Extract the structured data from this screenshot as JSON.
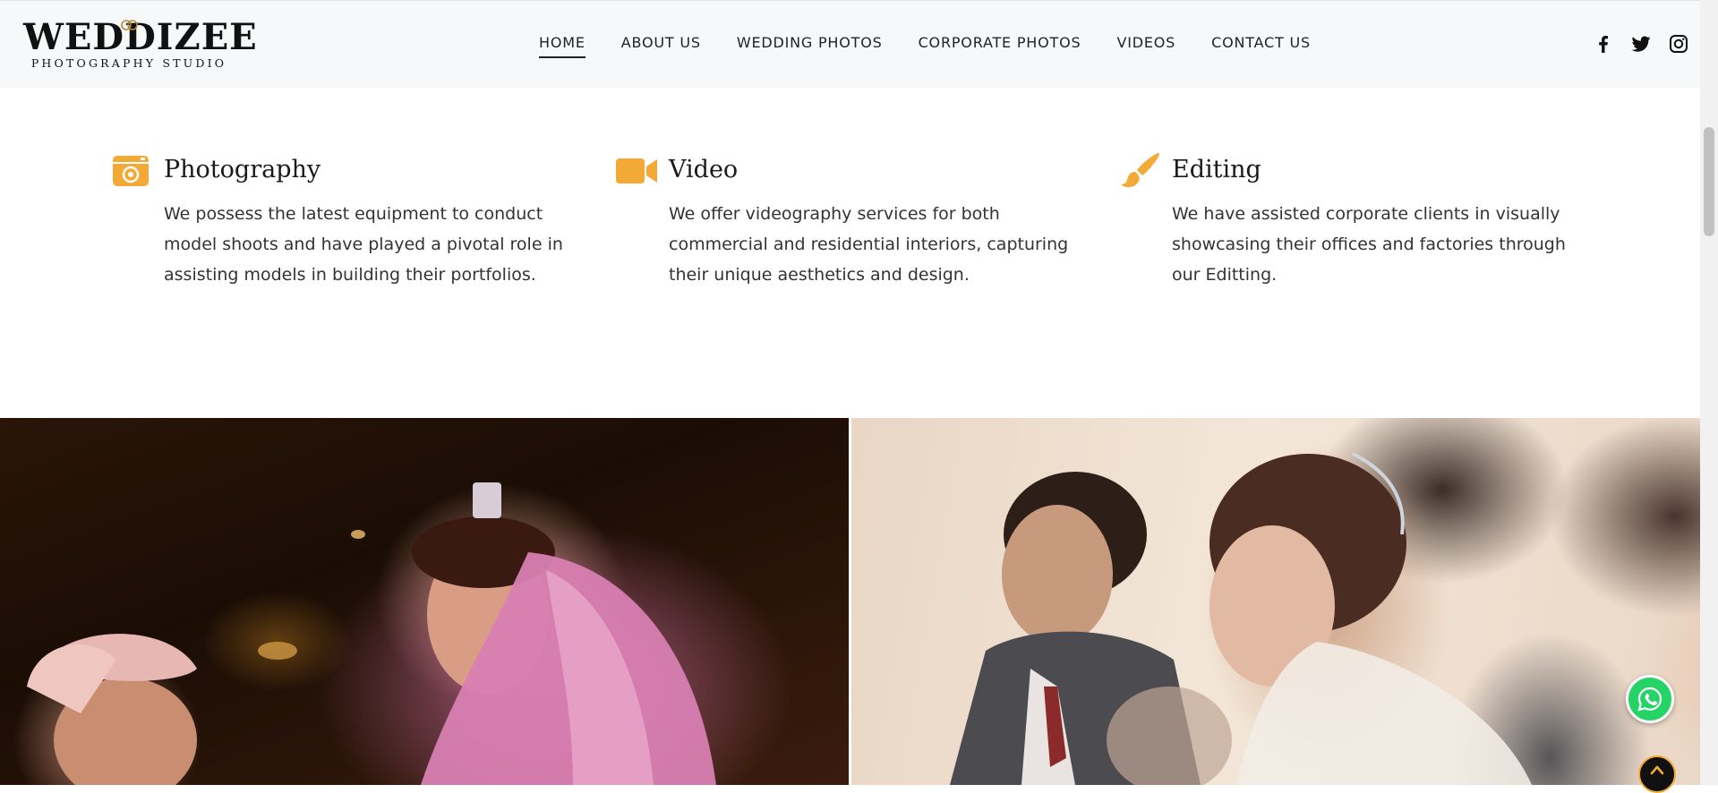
{
  "brand": {
    "name": "WEDDIZEE",
    "tagline": "PHOTOGRAPHY STUDIO"
  },
  "nav": {
    "items": [
      {
        "label": "HOME",
        "active": true
      },
      {
        "label": "ABOUT US",
        "active": false
      },
      {
        "label": "WEDDING PHOTOS",
        "active": false
      },
      {
        "label": "CORPORATE PHOTOS",
        "active": false
      },
      {
        "label": "VIDEOS",
        "active": false
      },
      {
        "label": "CONTACT US",
        "active": false
      }
    ]
  },
  "social": {
    "icons": [
      "facebook-icon",
      "twitter-icon",
      "instagram-icon"
    ]
  },
  "services": [
    {
      "icon": "camera-icon",
      "title": "Photography",
      "text": "We possess the latest equipment to conduct model shoots and have played a pivotal role in assisting models in building their portfolios."
    },
    {
      "icon": "video-camera-icon",
      "title": "Video",
      "text": "We offer videography services for both commercial and residential interiors, capturing their unique aesthetics and design."
    },
    {
      "icon": "paint-brush-icon",
      "title": "Editing",
      "text": "We have assisted corporate clients in visually showcasing their offices and factories through our Editting."
    }
  ],
  "gallery": {
    "photos": [
      "wedding-photo-bride-groom-pink",
      "wedding-photo-church-couple"
    ]
  },
  "floating": {
    "whatsapp_icon": "whatsapp-icon",
    "back_to_top_icon": "chevron-up-icon"
  },
  "colors": {
    "accent": "#f3a935",
    "header_bg": "#f7f8f9",
    "text": "#222222",
    "whatsapp": "#25d366"
  }
}
